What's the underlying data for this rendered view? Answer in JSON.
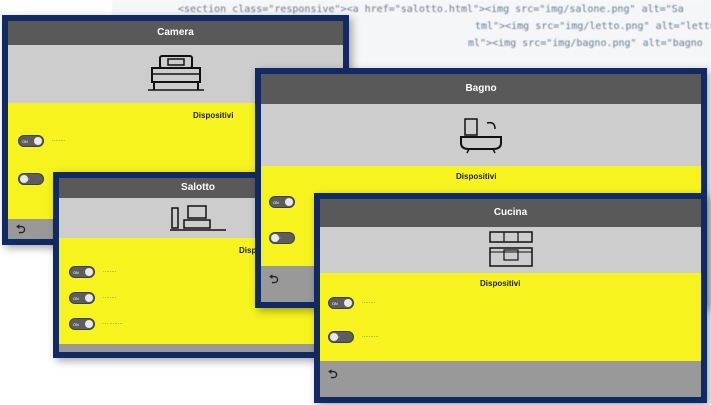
{
  "code_lines": [
    "<section class=\"responsive\"><a href=\"salotto.html\"><img src=\"img/salone.png\" alt=\"Sa",
    "tml\"><img src=\"img/letto.png\" alt=\"letto",
    "ml\"><img src=\"img/bagno.png\" alt=\"bagno"
  ],
  "windows": {
    "camera": {
      "title": "Camera",
      "subtitle": "Dispositivi",
      "devices": [
        {
          "toggle": "ON",
          "label": "········",
          "state": "on"
        },
        {
          "toggle": "OFF",
          "label": "",
          "state": "off"
        }
      ]
    },
    "salotto": {
      "title": "Salotto",
      "subtitle": "Dispositivi",
      "devices": [
        {
          "toggle": "ON",
          "label": "········",
          "state": "on"
        },
        {
          "toggle": "ON",
          "label": "········",
          "state": "on"
        },
        {
          "toggle": "ON",
          "label": "··· ········",
          "state": "on"
        }
      ]
    },
    "bagno": {
      "title": "Bagno",
      "subtitle": "Dispositivi",
      "devices": [
        {
          "toggle": "ON",
          "label": "",
          "state": "on"
        },
        {
          "toggle": "OFF",
          "label": "",
          "state": "off"
        }
      ]
    },
    "cucina": {
      "title": "Cucina",
      "subtitle": "Dispositivi",
      "devices": [
        {
          "toggle": "ON",
          "label": "········",
          "state": "on"
        },
        {
          "toggle": "OFF",
          "label": "··········",
          "state": "off"
        }
      ]
    }
  },
  "back_icon": "back-arrow-icon",
  "colors": {
    "frame": "#112a63",
    "header": "#595959",
    "yellow": "#f7f31f",
    "image_area": "#cdcdcd",
    "footer": "#999999"
  }
}
